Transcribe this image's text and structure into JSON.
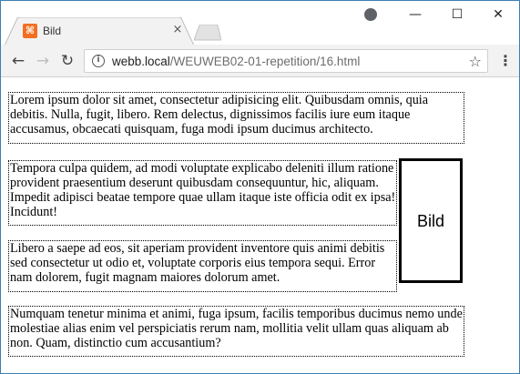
{
  "browser": {
    "tab": {
      "title": "Bild",
      "favicon_glyph": "⌘",
      "close_glyph": "×"
    },
    "window_controls": {
      "minimize": "—",
      "maximize": "☐",
      "close": "✕"
    },
    "toolbar": {
      "back_glyph": "←",
      "forward_glyph": "→",
      "reload_glyph": "↻",
      "info_glyph": "i",
      "url_host": "webb.local",
      "url_path": "/WEUWEB02-01-repetition/16.html",
      "star_glyph": "☆",
      "menu_glyph": "⋮"
    }
  },
  "page": {
    "paragraphs": [
      "Lorem ipsum dolor sit amet, consectetur adipisicing elit. Quibusdam omnis, quia debitis. Nulla, fugit, libero. Rem delectus, dignissimos facilis iure eum itaque accusamus, obcaecati quisquam, fuga modi ipsum ducimus architecto.",
      "Tempora culpa quidem, ad modi voluptate explicabo deleniti illum ratione provident praesentium deserunt quibusdam consequuntur, hic, aliquam. Impedit adipisci beatae tempore quae ullam itaque iste officia odit ex ipsa! Incidunt!",
      "Libero a saepe ad eos, sit aperiam provident inventore quis animi debitis sed consectetur ut odio et, voluptate corporis eius tempora sequi. Error nam dolorem, fugit magnam maiores dolorum amet.",
      "Numquam tenetur minima et animi, fuga ipsum, facilis temporibus ducimus nemo unde molestiae alias enim vel perspiciatis rerum nam, mollitia velit ullam quas aliquam ab non. Quam, distinctio cum accusantium?"
    ],
    "image_label": "Bild"
  },
  "colors": {
    "window_border": "#3c7fb1",
    "favicon": "#f26f21",
    "toolbar_bg": "#f2f2f2"
  }
}
